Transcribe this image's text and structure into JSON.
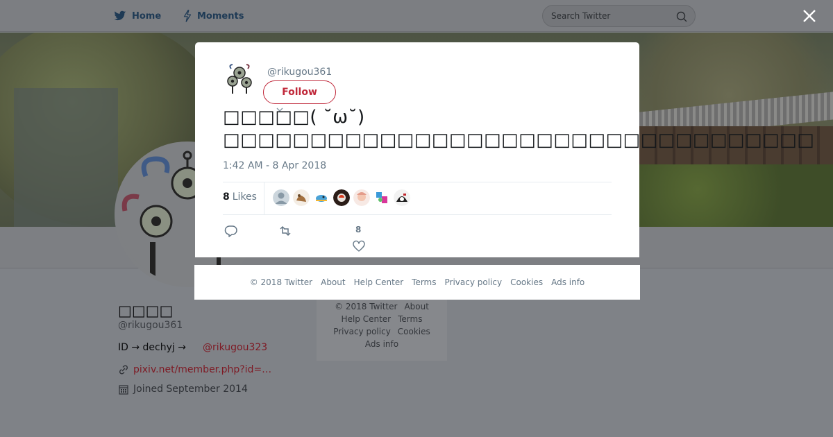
{
  "nav": {
    "home_label": "Home",
    "moments_label": "Moments",
    "search_placeholder": "Search Twitter",
    "icons": [
      "twitter-bird-icon",
      "lightning-icon",
      "search-icon",
      "close-icon"
    ],
    "colors": {
      "icon": "#1e3a55"
    }
  },
  "profile": {
    "name": "□□□□",
    "handle": "@rikugou361",
    "bio_text": "ID → dechyj  →",
    "bio_mention": "@rikugou323",
    "link": "pixiv.net/member.php?id=…",
    "joined": "Joined September 2014",
    "icons": [
      "link-icon",
      "calendar-icon"
    ],
    "colors": {
      "link": "#7e1a24"
    }
  },
  "side_footer": {
    "links": [
      "© 2018 Twitter",
      "About",
      "Help Center",
      "Terms",
      "Privacy policy",
      "Cookies",
      "Ads info"
    ]
  },
  "tweet": {
    "handle": "@rikugou361",
    "follow_label": "Follow",
    "text": "□□□□□( ˘ω˘)\n□□□□□□□□□□□□□□□□□□□□□□□□□□□□□□□□□□",
    "timestamp": "1:42 AM - 8 Apr 2018",
    "likes_count": "8",
    "likes_label": "Likes",
    "like_action_count": "8",
    "liker_avatars": [
      "default-avatar",
      "animal-avatar",
      "bird-avatar",
      "dark-avatar",
      "pink-avatar",
      "colorful-avatar",
      "bw-avatar"
    ],
    "icons": [
      "reply-icon",
      "retweet-icon",
      "heart-icon"
    ],
    "colors": {
      "follow": "#c0283a",
      "meta": "#657786"
    }
  },
  "modal_footer": {
    "links": [
      "© 2018 Twitter",
      "About",
      "Help Center",
      "Terms",
      "Privacy policy",
      "Cookies",
      "Ads info"
    ]
  }
}
